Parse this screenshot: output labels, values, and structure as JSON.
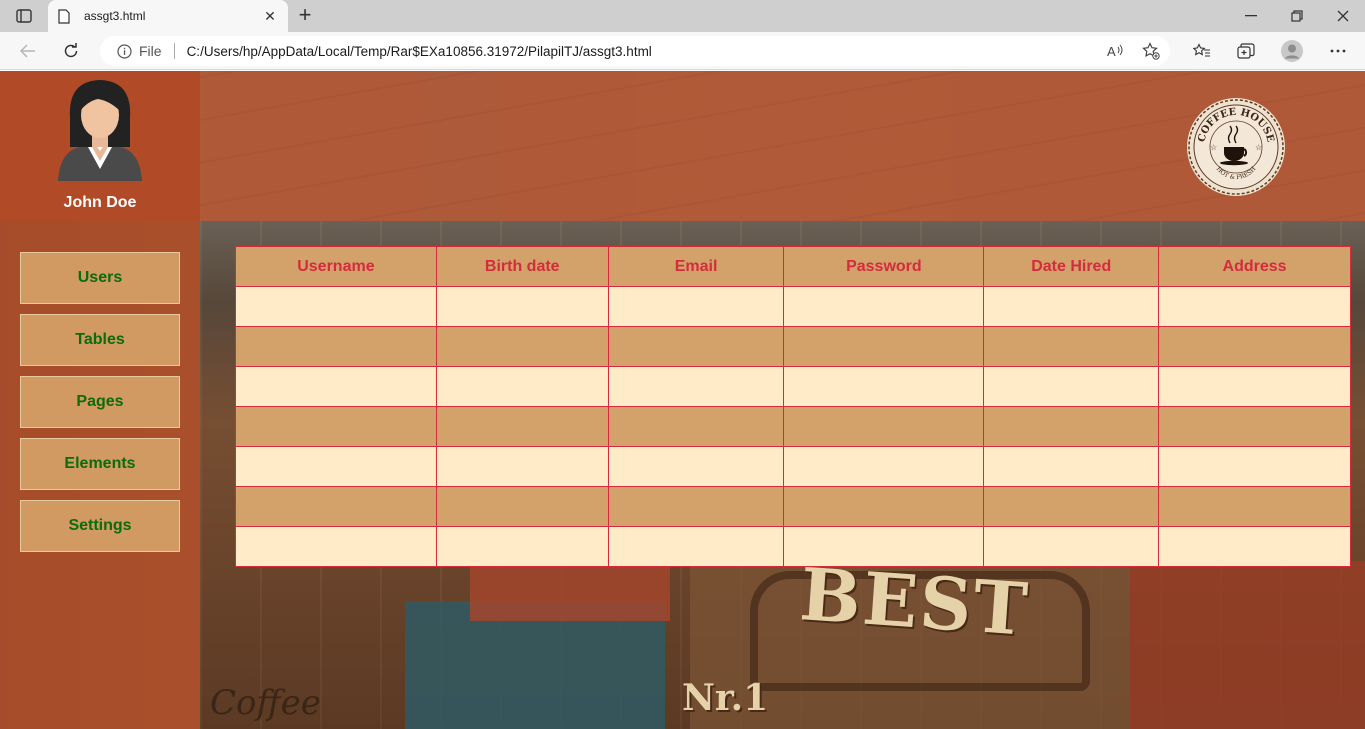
{
  "browser": {
    "tab_title": "assgt3.html",
    "new_tab_label": "+",
    "file_label": "File",
    "url": "C:/Users/hp/AppData/Local/Temp/Rar$EXa10856.31972/PilapilTJ/assgt3.html",
    "icons": [
      "tab-actions-icon",
      "page-icon",
      "close-icon",
      "minimize-icon",
      "restore-icon",
      "window-close-icon",
      "back-icon",
      "refresh-icon",
      "info-icon",
      "read-aloud-icon",
      "add-favorite-icon",
      "favorites-icon",
      "collections-icon",
      "profile-icon",
      "more-icon"
    ]
  },
  "profile": {
    "name": "John Doe"
  },
  "menu": {
    "items": [
      {
        "label": "Users"
      },
      {
        "label": "Tables"
      },
      {
        "label": "Pages"
      },
      {
        "label": "Elements"
      },
      {
        "label": "Settings"
      }
    ]
  },
  "logo": {
    "top_text": "COFFEE HOUSE",
    "bottom_text": "HOT & FRESH"
  },
  "table": {
    "headers": [
      "Username",
      "Birth date",
      "Email",
      "Password",
      "Date Hired",
      "Address"
    ],
    "rows": [
      [
        "",
        "",
        "",
        "",
        "",
        ""
      ],
      [
        "",
        "",
        "",
        "",
        "",
        ""
      ],
      [
        "",
        "",
        "",
        "",
        "",
        ""
      ],
      [
        "",
        "",
        "",
        "",
        "",
        ""
      ],
      [
        "",
        "",
        "",
        "",
        "",
        ""
      ],
      [
        "",
        "",
        "",
        "",
        "",
        ""
      ],
      [
        "",
        "",
        "",
        "",
        "",
        ""
      ]
    ]
  },
  "background_text": {
    "best": "BEST",
    "nr": "Nr.1",
    "coffee": "Coffee"
  },
  "colors": {
    "header_band": "#b25a39",
    "sidebar": "#b14a27",
    "menu_button": "#d09a62",
    "menu_text": "#0c6b0c",
    "table_border": "#d42c3c",
    "table_header_text": "#d42c3c",
    "row_light": "#ffebc8",
    "row_dark": "#d3a26b"
  }
}
